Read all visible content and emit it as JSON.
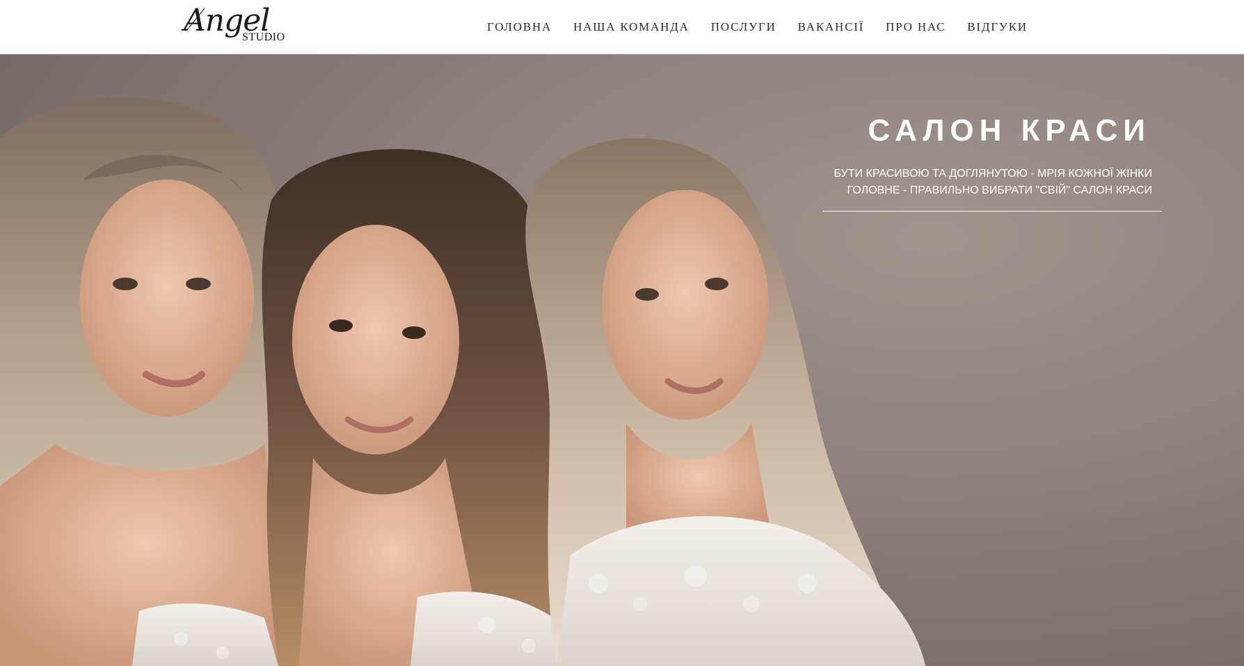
{
  "header": {
    "logo": {
      "main": "Angel",
      "sub": "STUDIO"
    },
    "nav": [
      {
        "label": "ГОЛОВНА",
        "name": "nav-home"
      },
      {
        "label": "НАША КОМАНДА",
        "name": "nav-team"
      },
      {
        "label": "ПОСЛУГИ",
        "name": "nav-services"
      },
      {
        "label": "ВАКАНСІЇ",
        "name": "nav-vacancies"
      },
      {
        "label": "ПРО НАС",
        "name": "nav-about"
      },
      {
        "label": "ВІДГУКИ",
        "name": "nav-reviews"
      }
    ]
  },
  "hero": {
    "title": "САЛОН КРАСИ",
    "subtitle_line1": "БУТИ КРАСИВОЮ ТА ДОГЛЯНУТОЮ - МРІЯ КОЖНОЇ ЖІНКИ",
    "subtitle_line2": "ГОЛОВНЕ - ПРАВИЛЬНО ВИБРАТИ \"СВІЙ\" САЛОН КРАСИ"
  },
  "colors": {
    "hero_background": "#8b7f7b",
    "header_background": "#ffffff",
    "nav_text": "#2b2b2b",
    "hero_text": "#ffffff"
  }
}
